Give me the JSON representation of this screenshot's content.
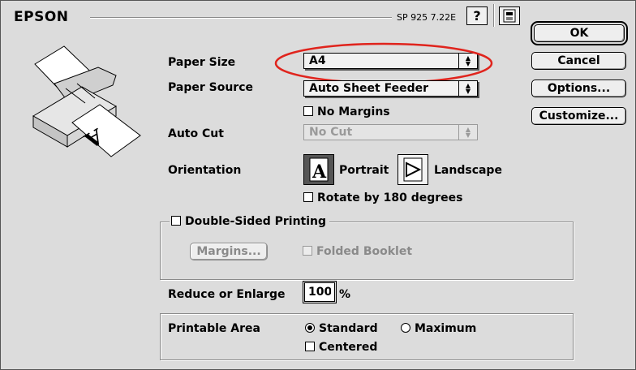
{
  "brand": "EPSON",
  "version": "SP 925 7.22E",
  "buttons": {
    "ok": "OK",
    "cancel": "Cancel",
    "options": "Options...",
    "customize": "Customize...",
    "margins": "Margins..."
  },
  "paper_size": {
    "label": "Paper Size",
    "value": "A4"
  },
  "paper_source": {
    "label": "Paper Source",
    "value": "Auto Sheet Feeder"
  },
  "no_margins": {
    "label": "No Margins",
    "checked": false
  },
  "auto_cut": {
    "label": "Auto Cut",
    "value": "No Cut",
    "enabled": false
  },
  "orientation": {
    "label": "Orientation",
    "portrait": "Portrait",
    "landscape": "Landscape",
    "selected": "Portrait",
    "portrait_glyph": "A"
  },
  "rotate": {
    "label": "Rotate by 180 degrees",
    "checked": false
  },
  "double_sided": {
    "label": "Double-Sided Printing",
    "checked": false,
    "folded_booklet": "Folded Booklet"
  },
  "reduce": {
    "label": "Reduce or Enlarge",
    "value": "100",
    "unit": "%"
  },
  "printable_area": {
    "label": "Printable Area",
    "standard": "Standard",
    "maximum": "Maximum",
    "selected": "Standard",
    "centered": "Centered",
    "centered_checked": false
  },
  "icons": {
    "help": "?",
    "printer_glyph": "A"
  },
  "colors": {
    "annotation": "#e0241d"
  }
}
